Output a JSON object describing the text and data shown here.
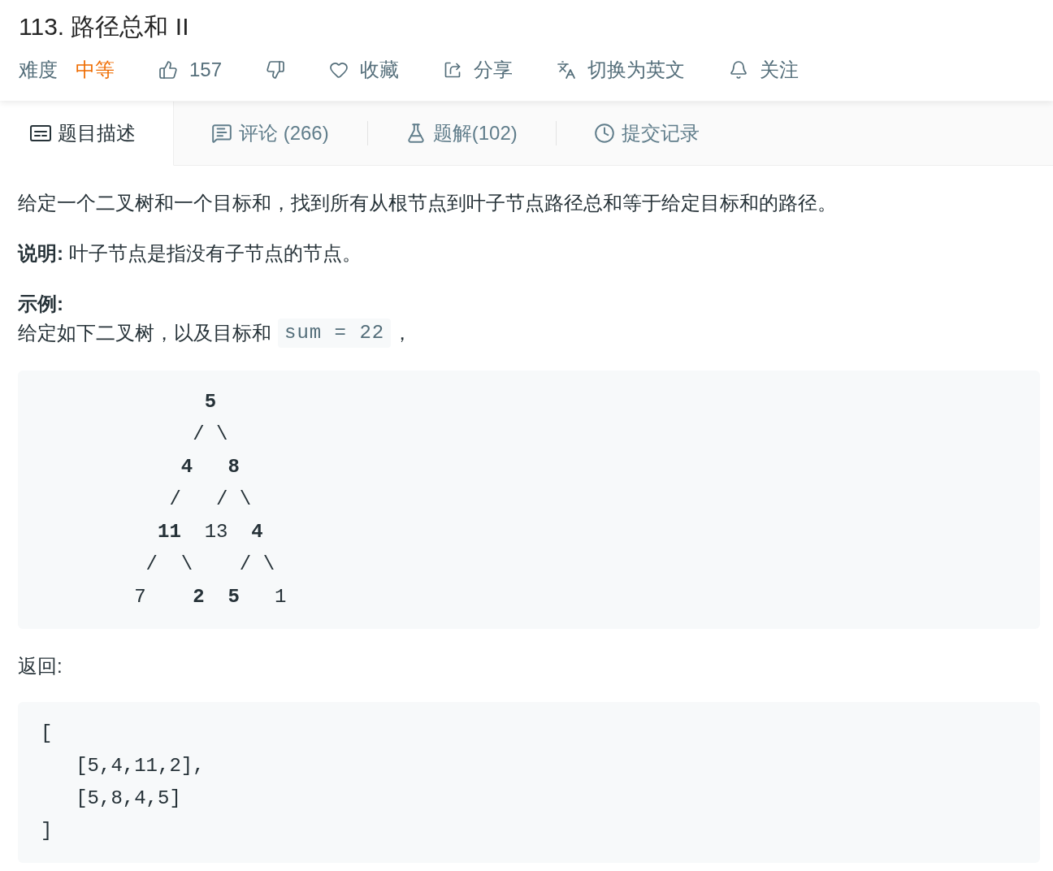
{
  "title": "113. 路径总和 II",
  "meta": {
    "difficulty_label": "难度",
    "difficulty": {
      "text": "中等",
      "kind": "medium"
    },
    "actions": [
      {
        "kind": "like",
        "label": "157"
      },
      {
        "kind": "dislike"
      },
      {
        "kind": "favorite",
        "label": "收藏"
      },
      {
        "kind": "share",
        "label": "分享"
      },
      {
        "kind": "translate",
        "label": "切换为英文"
      },
      {
        "kind": "follow",
        "label": "关注"
      }
    ]
  },
  "tabs": [
    {
      "kind": "description",
      "label": "题目描述",
      "selected": true
    },
    {
      "kind": "comments",
      "label": "评论 (266)",
      "selected": false
    },
    {
      "kind": "solutions",
      "label": "题解(102)",
      "selected": false
    },
    {
      "kind": "submissions",
      "label": "提交记录",
      "selected": false
    }
  ],
  "content": [
    {
      "kind": "paragraph",
      "text": "给定一个二叉树和一个目标和，找到所有从根节点到叶子节点路径总和等于给定目标和的路径。"
    },
    {
      "kind": "paragraph",
      "text": "**说明:** 叶子节点是指没有子节点的节点。"
    },
    {
      "kind": "heading",
      "text": "示例:"
    },
    {
      "kind": "sentence",
      "parts": [
        {
          "kind": "text",
          "text": "给定如下二叉树，以及目标和"
        },
        {
          "kind": "code",
          "text": "sum = 22"
        },
        {
          "kind": "text",
          "text": "，"
        }
      ]
    },
    {
      "kind": "code",
      "lines": [
        "              **5**",
        "             / \\",
        "            **4**   **8**",
        "           /   / \\",
        "          **11**  13  **4**",
        "         /  \\    / \\",
        "        7    **2**  **5**   1"
      ]
    },
    {
      "kind": "paragraph",
      "text": "返回:"
    },
    {
      "kind": "code",
      "lines": [
        "[",
        "   [5,4,11,2],",
        "   [5,8,4,5]",
        "]"
      ]
    }
  ]
}
